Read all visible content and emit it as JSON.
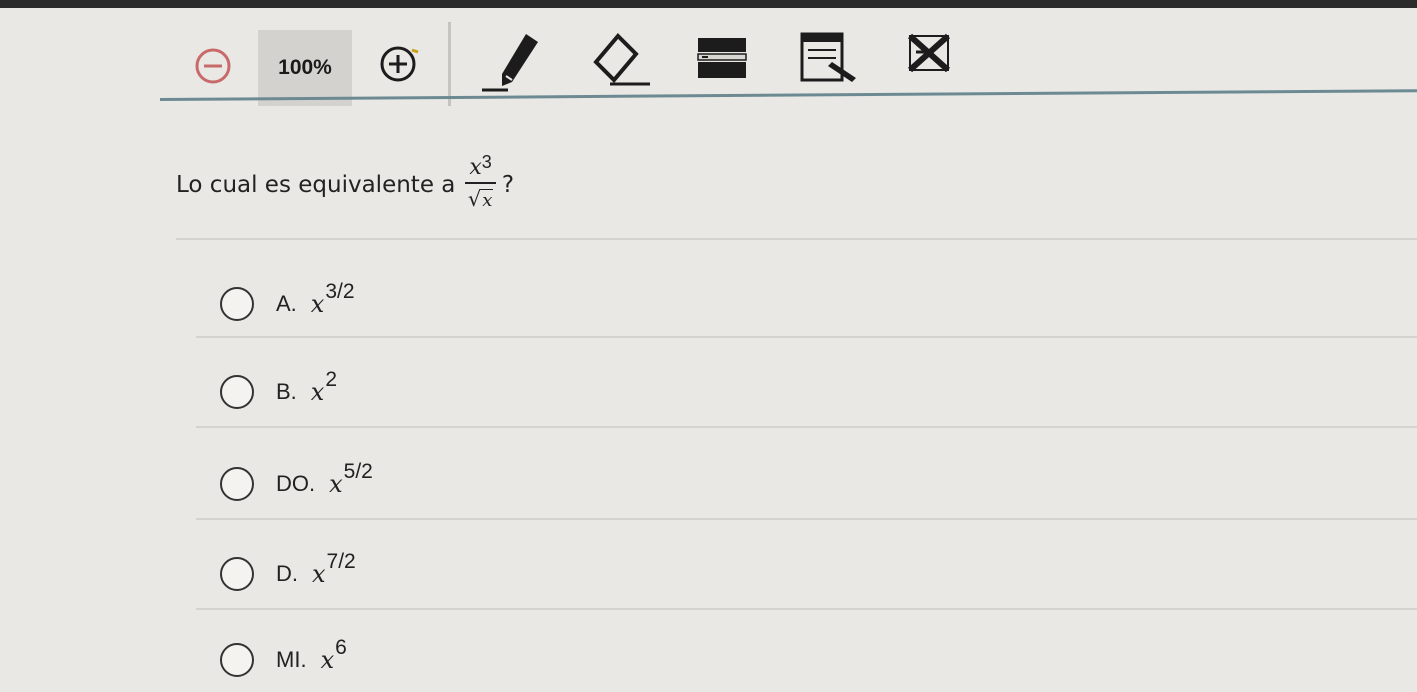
{
  "toolbar": {
    "zoom_value": "100%",
    "tools": [
      {
        "name": "zoom-out-icon"
      },
      {
        "name": "zoom-in-icon"
      },
      {
        "name": "pencil-icon"
      },
      {
        "name": "eraser-icon"
      },
      {
        "name": "line-reader-icon"
      },
      {
        "name": "notepad-icon"
      },
      {
        "name": "answer-eliminator-icon"
      }
    ]
  },
  "question": {
    "prefix": "Lo cual es equivalente a",
    "numerator_base": "x",
    "numerator_exp": "3",
    "denominator_symbol": "√",
    "denominator_radicand": "x",
    "suffix": "?"
  },
  "options": [
    {
      "label": "A.",
      "base": "x",
      "exp": "3/2"
    },
    {
      "label": "B.",
      "base": "x",
      "exp": "2"
    },
    {
      "label": "DO.",
      "base": "x",
      "exp": "5/2"
    },
    {
      "label": "D.",
      "base": "x",
      "exp": "7/2"
    },
    {
      "label": "MI.",
      "base": "x",
      "exp": "6"
    }
  ],
  "colors": {
    "background": "#e9e8e4",
    "toolbar_rule": "#6d8a93",
    "zoom_box": "#d3d2ce",
    "text": "#1d1d1d"
  }
}
